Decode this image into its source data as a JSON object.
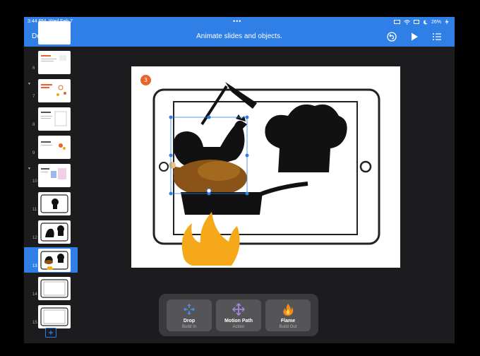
{
  "status": {
    "time": "3:44 PM",
    "date": "Wed Feb 7",
    "battery": "26%"
  },
  "navbar": {
    "done_label": "Done",
    "title": "Animate slides and objects."
  },
  "sidebar": {
    "slides": [
      {
        "number": "6"
      },
      {
        "number": "7"
      },
      {
        "number": "8"
      },
      {
        "number": "9"
      },
      {
        "number": "10"
      },
      {
        "number": "11"
      },
      {
        "number": "12"
      },
      {
        "number": "13"
      },
      {
        "number": "14"
      },
      {
        "number": "15"
      }
    ]
  },
  "slide": {
    "build_order_badge": "3"
  },
  "builds": [
    {
      "name": "Drop",
      "subtitle": "Build In",
      "icon": "drop-arrows-icon"
    },
    {
      "name": "Motion Path",
      "subtitle": "Action",
      "icon": "motion-path-icon"
    },
    {
      "name": "Flame",
      "subtitle": "Build Out",
      "icon": "flame-icon"
    }
  ],
  "colors": {
    "accent": "#2f7fe6",
    "badge": "#e8642c",
    "flame": "#f4a81a",
    "roast": "#8a5418"
  }
}
